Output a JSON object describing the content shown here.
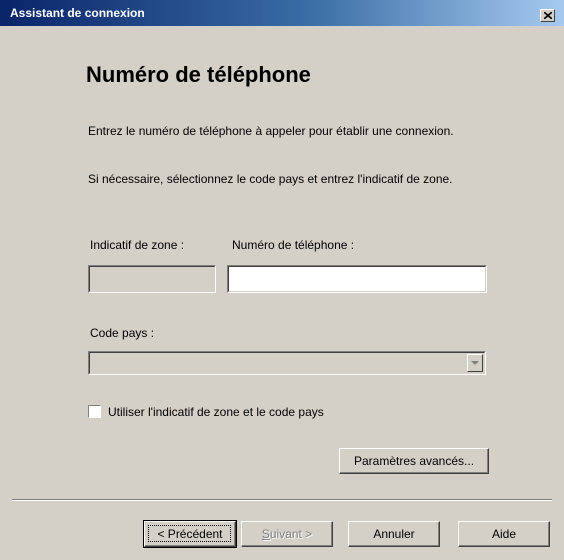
{
  "window": {
    "title": "Assistant de connexion",
    "close_icon": "close-icon"
  },
  "content": {
    "heading": "Numéro de téléphone",
    "instruction_1": "Entrez le numéro de téléphone à appeler pour établir une connexion.",
    "instruction_2": "Si nécessaire, sélectionnez le code pays et entrez l'indicatif de zone.",
    "area_code_label": "Indicatif de zone :",
    "area_code_value": "",
    "phone_label": "Numéro de téléphone :",
    "phone_value": "",
    "country_label": "Code pays :",
    "country_value": "",
    "checkbox_label": "Utiliser l'indicatif de zone et le code pays",
    "checkbox_checked": false,
    "advanced_button": "Paramètres avancés..."
  },
  "footer": {
    "back_button": "< Précédent",
    "next_button_accel": "S",
    "next_button_rest": "uivant >",
    "cancel_button": "Annuler",
    "help_button": "Aide"
  }
}
